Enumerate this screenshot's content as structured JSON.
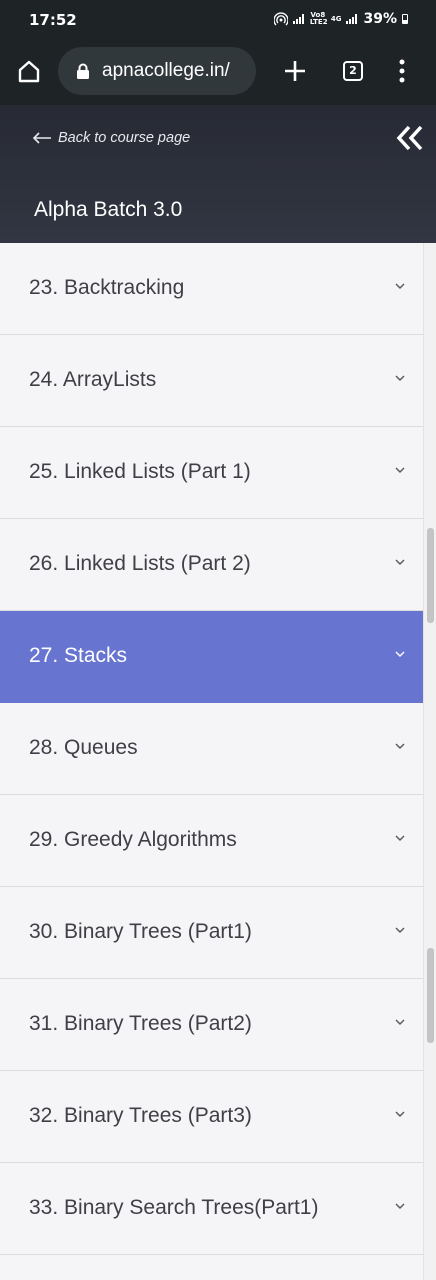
{
  "status_bar": {
    "time": "17:52",
    "battery": "39%",
    "network_label_1": "Vo8 LTE2",
    "network_label_2": "4G"
  },
  "browser": {
    "url": "apnacollege.in/",
    "tab_count": "2",
    "icons": [
      "home-icon",
      "lock-icon",
      "plus-icon",
      "tabs-icon",
      "overflow-menu-icon"
    ]
  },
  "course": {
    "back_label": "Back to course page",
    "title": "Alpha Batch 3.0"
  },
  "chapters": [
    {
      "label": "23. Backtracking",
      "active": false
    },
    {
      "label": "24. ArrayLists",
      "active": false
    },
    {
      "label": "25. Linked Lists (Part 1)",
      "active": false
    },
    {
      "label": "26. Linked Lists (Part 2)",
      "active": false
    },
    {
      "label": "27. Stacks",
      "active": true
    },
    {
      "label": "28. Queues",
      "active": false
    },
    {
      "label": "29. Greedy Algorithms",
      "active": false
    },
    {
      "label": "30. Binary Trees (Part1)",
      "active": false
    },
    {
      "label": "31. Binary Trees (Part2)",
      "active": false
    },
    {
      "label": "32. Binary Trees (Part3)",
      "active": false
    },
    {
      "label": "33. Binary Search Trees(Part1)",
      "active": false
    }
  ],
  "colors": {
    "active_item": "#6775d1",
    "header_bg": "#2e323c",
    "browser_bg": "#1e2326"
  }
}
